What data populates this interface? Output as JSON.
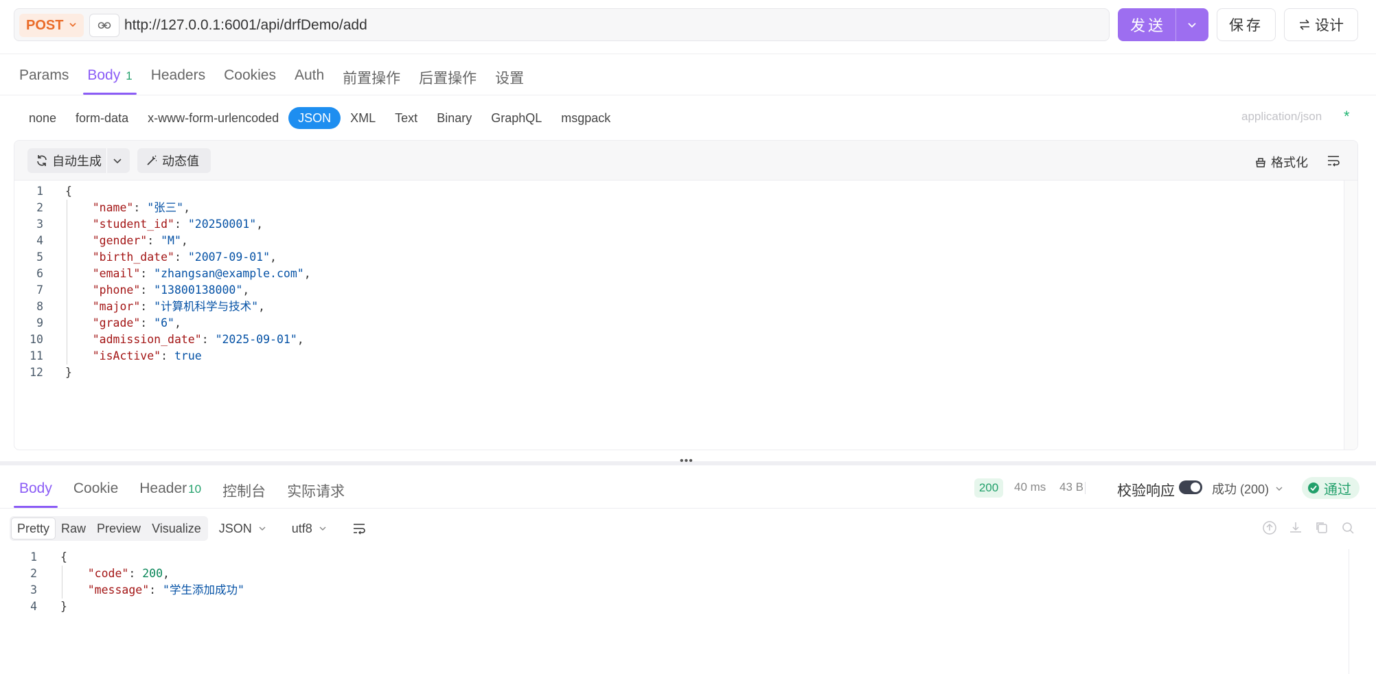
{
  "request": {
    "method": "POST",
    "url": "http://127.0.0.1:6001/api/drfDemo/add",
    "send_label": "发送",
    "save_label": "保存",
    "design_label": "设计"
  },
  "request_tabs": [
    {
      "label": "Params"
    },
    {
      "label": "Body",
      "badge": "1"
    },
    {
      "label": "Headers"
    },
    {
      "label": "Cookies"
    },
    {
      "label": "Auth"
    },
    {
      "label": "前置操作"
    },
    {
      "label": "后置操作"
    },
    {
      "label": "设置"
    }
  ],
  "body_types": [
    "none",
    "form-data",
    "x-www-form-urlencoded",
    "JSON",
    "XML",
    "Text",
    "Binary",
    "GraphQL",
    "msgpack"
  ],
  "active_body_type": "JSON",
  "content_type": "application/json",
  "required_mark": "*",
  "editor": {
    "autogen_label": "自动生成",
    "dynamic_label": "动态值",
    "format_label": "格式化",
    "lines": [
      {
        "n": "1",
        "tokens": [
          [
            "p",
            "{"
          ]
        ]
      },
      {
        "n": "2",
        "tokens": [
          [
            "k",
            "    \"name\""
          ],
          [
            "p",
            ": "
          ],
          [
            "s",
            "\"张三\""
          ],
          [
            "p",
            ","
          ]
        ]
      },
      {
        "n": "3",
        "tokens": [
          [
            "k",
            "    \"student_id\""
          ],
          [
            "p",
            ": "
          ],
          [
            "s",
            "\"20250001\""
          ],
          [
            "p",
            ","
          ]
        ]
      },
      {
        "n": "4",
        "tokens": [
          [
            "k",
            "    \"gender\""
          ],
          [
            "p",
            ": "
          ],
          [
            "s",
            "\"M\""
          ],
          [
            "p",
            ","
          ]
        ]
      },
      {
        "n": "5",
        "tokens": [
          [
            "k",
            "    \"birth_date\""
          ],
          [
            "p",
            ": "
          ],
          [
            "s",
            "\"2007-09-01\""
          ],
          [
            "p",
            ","
          ]
        ]
      },
      {
        "n": "6",
        "tokens": [
          [
            "k",
            "    \"email\""
          ],
          [
            "p",
            ": "
          ],
          [
            "s",
            "\"zhangsan@example.com\""
          ],
          [
            "p",
            ","
          ]
        ]
      },
      {
        "n": "7",
        "tokens": [
          [
            "k",
            "    \"phone\""
          ],
          [
            "p",
            ": "
          ],
          [
            "s",
            "\"13800138000\""
          ],
          [
            "p",
            ","
          ]
        ]
      },
      {
        "n": "8",
        "tokens": [
          [
            "k",
            "    \"major\""
          ],
          [
            "p",
            ": "
          ],
          [
            "s",
            "\"计算机科学与技术\""
          ],
          [
            "p",
            ","
          ]
        ]
      },
      {
        "n": "9",
        "tokens": [
          [
            "k",
            "    \"grade\""
          ],
          [
            "p",
            ": "
          ],
          [
            "s",
            "\"6\""
          ],
          [
            "p",
            ","
          ]
        ]
      },
      {
        "n": "10",
        "tokens": [
          [
            "k",
            "    \"admission_date\""
          ],
          [
            "p",
            ": "
          ],
          [
            "s",
            "\"2025-09-01\""
          ],
          [
            "p",
            ","
          ]
        ]
      },
      {
        "n": "11",
        "tokens": [
          [
            "k",
            "    \"isActive\""
          ],
          [
            "p",
            ": "
          ],
          [
            "b",
            "true"
          ]
        ]
      },
      {
        "n": "12",
        "tokens": [
          [
            "p",
            "}"
          ]
        ]
      }
    ]
  },
  "response_tabs": [
    {
      "label": "Body"
    },
    {
      "label": "Cookie"
    },
    {
      "label": "Header",
      "badge": "10"
    },
    {
      "label": "控制台"
    },
    {
      "label": "实际请求"
    }
  ],
  "response_status": {
    "code": "200",
    "time": "40 ms",
    "size": "43 B",
    "validate_label": "校验响应",
    "result_select": "成功 (200)",
    "pass_label": "通过"
  },
  "response_view_modes": [
    "Pretty",
    "Raw",
    "Preview",
    "Visualize"
  ],
  "active_view_mode": "Pretty",
  "response_format": "JSON",
  "response_encoding": "utf8",
  "response_body": {
    "lines": [
      {
        "n": "1",
        "tokens": [
          [
            "p",
            "{"
          ]
        ]
      },
      {
        "n": "2",
        "tokens": [
          [
            "k",
            "    \"code\""
          ],
          [
            "p",
            ": "
          ],
          [
            "n",
            "200"
          ],
          [
            "p",
            ","
          ]
        ]
      },
      {
        "n": "3",
        "tokens": [
          [
            "k",
            "    \"message\""
          ],
          [
            "p",
            ": "
          ],
          [
            "s",
            "\"学生添加成功\""
          ]
        ]
      },
      {
        "n": "4",
        "tokens": [
          [
            "p",
            "}"
          ]
        ]
      }
    ]
  },
  "colors": {
    "accent": "#8b5cf6",
    "send_button": "#9d6ef0",
    "method_post": "#ea6b28",
    "json_active": "#1e8ef0",
    "success": "#22a06b"
  }
}
